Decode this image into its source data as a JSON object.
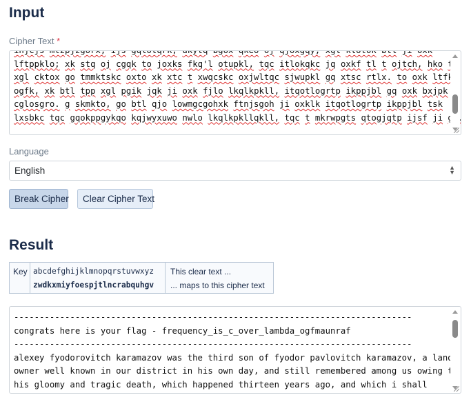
{
  "input": {
    "title": "Input",
    "cipher_label": "Cipher Text",
    "required_mark": "*",
    "cipher_lines": [
      "ihjcjs mtzpjzgorx, ijs gqlotqrk, ukytq bgox qkeo oj qjoxgqy; xgl klotok btl ji oxk",
      "lftppklo; xk stq oj cgqk to joxks fkq'l otupkl, tqc itlokqkc jq oxkf tl t ojtch, hko to",
      "xgl cktox go tmmktskc oxto xk xtc t xwqcskc oxjwltqc sjwupkl gq xtsc rtlx. to oxk ltfk",
      "ogfk, xk btl tpp xgl pgik jqk ji oxk fjlo lkqlkpkll, itqotlogrtp ikppjbl gq oxk bxjpk",
      "cglosgro. g skmkto, go btl qjo lowmgcgohxk ftnjsgoh ji oxklk itqotlogrtp ikppjbl tsk",
      "lxsbkc tqc gqokppgykqo kqjwyxuwo nwlo lkqlkpkllqkll, tqc t mkrwpgts qtogjqtp ijsf ji go."
    ],
    "language_label": "Language",
    "language_value": "English",
    "break_button": "Break Cipher",
    "clear_button": "Clear Cipher Text"
  },
  "result": {
    "title": "Result",
    "key_header": "Key",
    "plain_alphabet": "abcdefghijklmnopqrstuvwxyz",
    "cipher_alphabet": "zwdkxmiyfoespjtlncrabquhgv",
    "plain_caption": "This clear text ...",
    "cipher_caption": "... maps to this cipher text",
    "output_lines": [
      "------------------------------------------------------------------------------",
      "congrats here is your flag - frequency_is_c_over_lambda_ogfmaunraf",
      "------------------------------------------------------------------------------",
      "alexey fyodorovitch karamazov was the third son of fyodor pavlovitch karamazov, a land",
      "owner well known in our district in his own day, and still remembered among us owing to",
      "his gloomy and tragic death, which happened thirteen years ago, and which i shall"
    ]
  },
  "colors": {
    "heading": "#1a2b49",
    "required": "#dc3545",
    "primary_button": "#c8d7ea",
    "secondary_button": "#e6eef8"
  }
}
